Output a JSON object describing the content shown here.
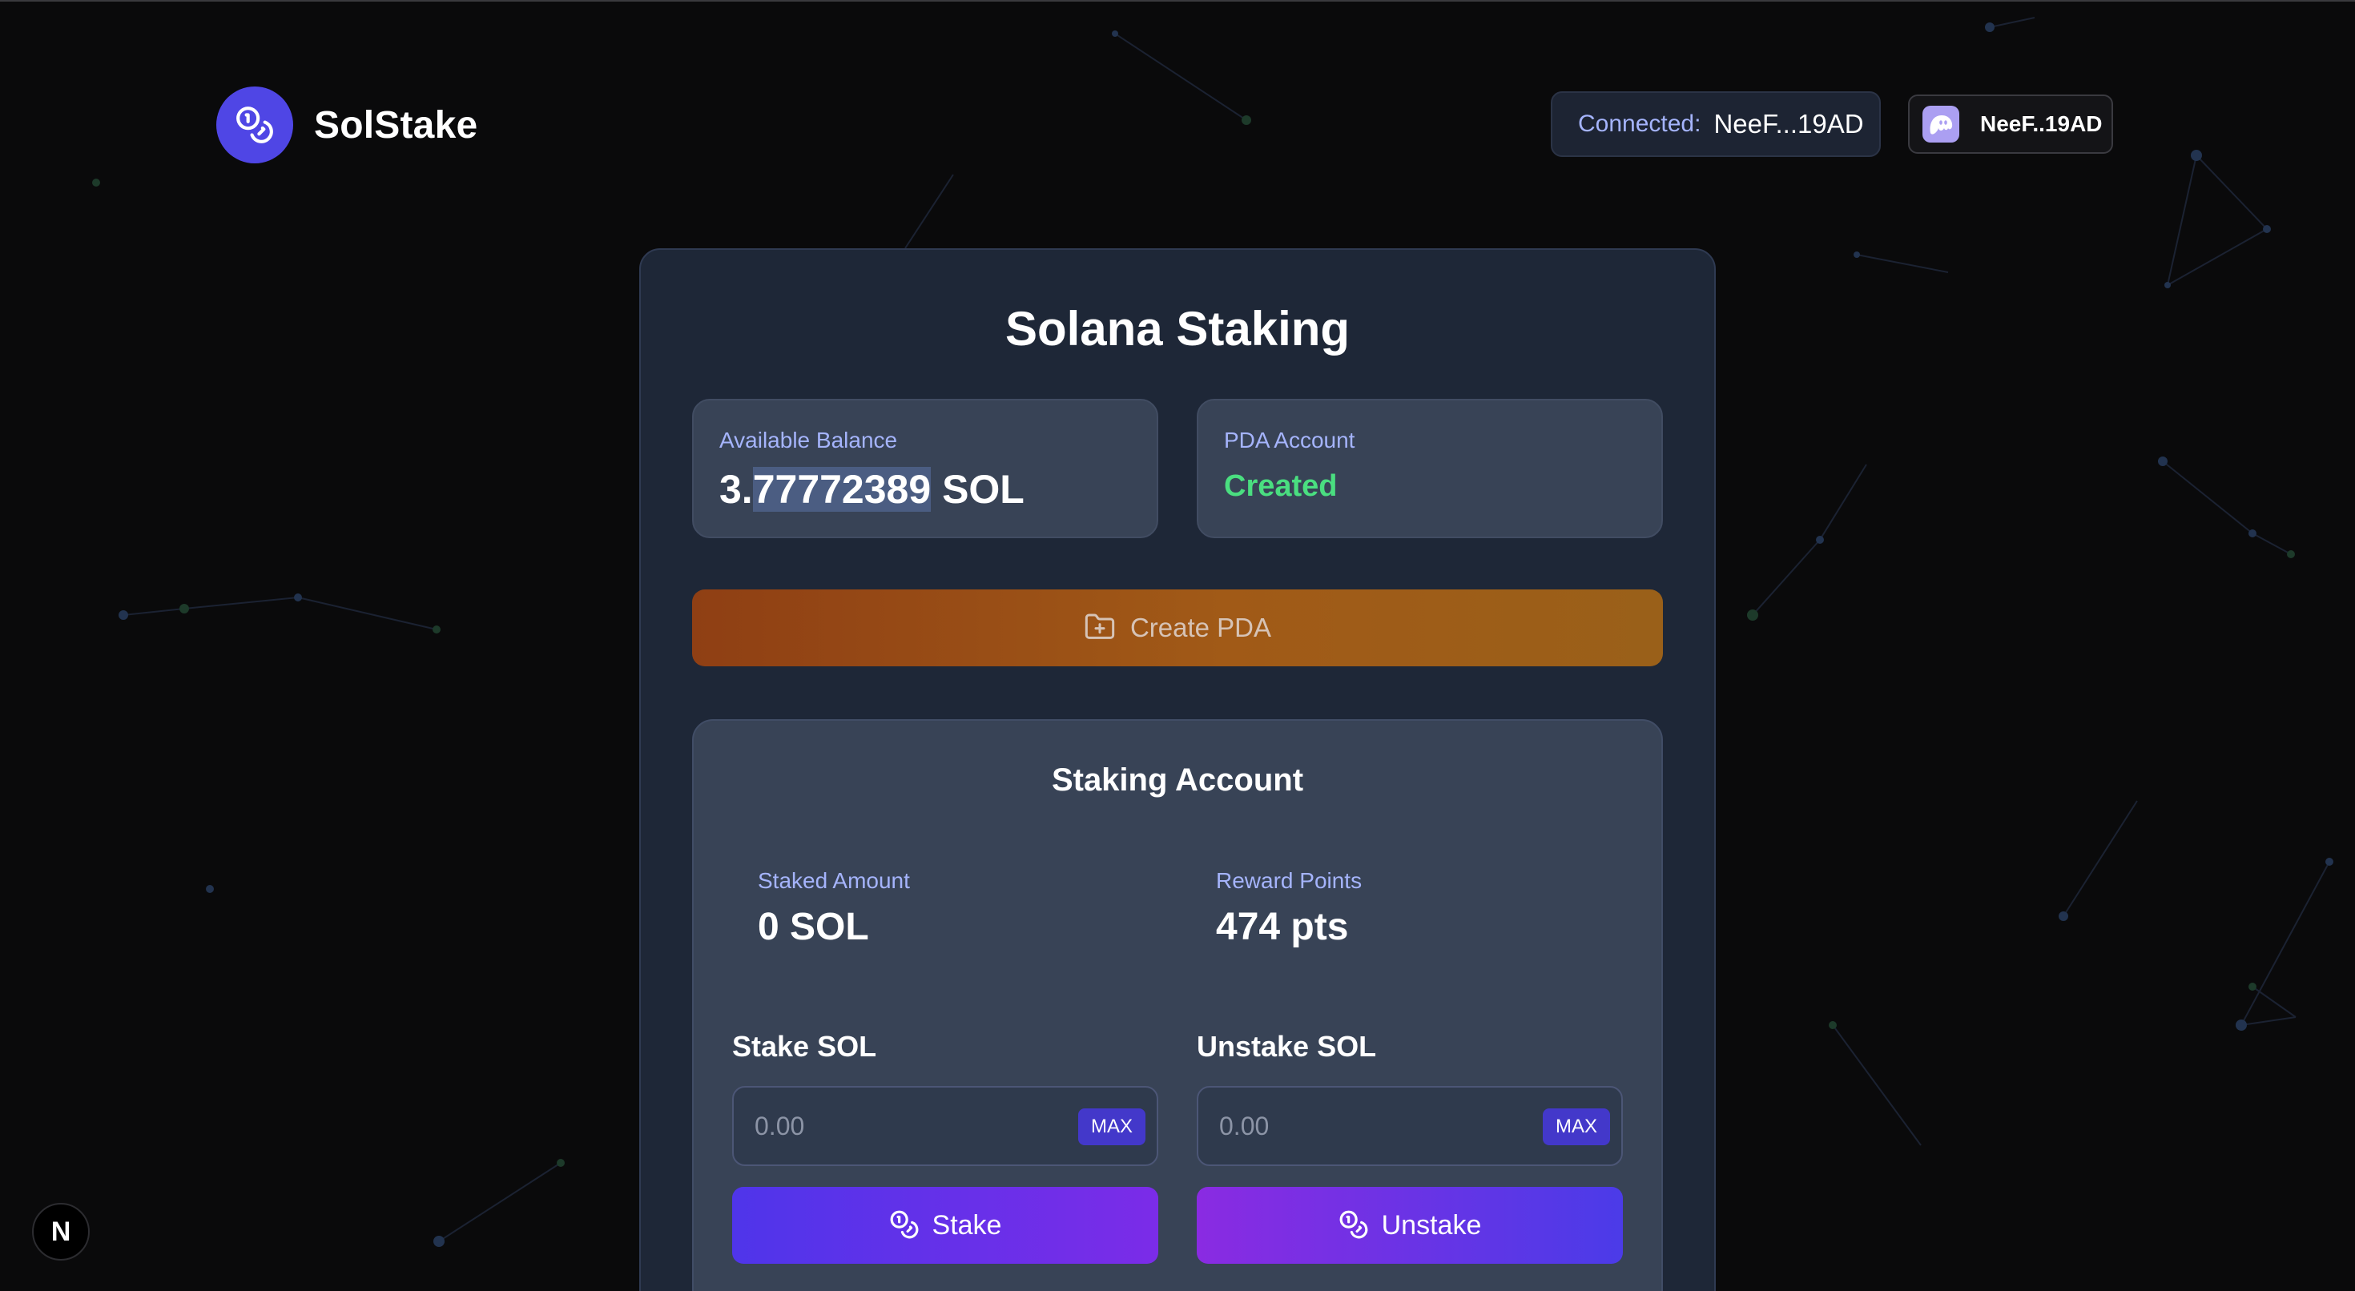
{
  "colors": {
    "background": "#0a0a0b",
    "accent": "#4f46e5",
    "card": "#1e2737",
    "panel": "#384356",
    "label": "#a5b4fc",
    "success": "#4ade80",
    "pda_gradient": [
      "#8f3f14",
      "#9a6019"
    ]
  },
  "header": {
    "brand_icon": "coins-icon",
    "brand_name": "SolStake",
    "connected_label": "Connected:",
    "connected_address": "NeeF...19AD",
    "wallet_icon": "phantom-ghost-icon",
    "wallet_address": "NeeF..19AD"
  },
  "card": {
    "title": "Solana Staking",
    "balance": {
      "label": "Available Balance",
      "value_prefix": "3.",
      "value_selected": "77772389",
      "value_suffix": " SOL"
    },
    "pda": {
      "label": "PDA Account",
      "status": "Created"
    },
    "create_pda": {
      "icon": "folder-plus-icon",
      "label": "Create PDA"
    },
    "staking_account": {
      "title": "Staking Account",
      "staked_label": "Staked Amount",
      "staked_value": "0 SOL",
      "reward_label": "Reward Points",
      "reward_value": "474 pts",
      "stake": {
        "heading": "Stake SOL",
        "placeholder": "0.00",
        "max_label": "MAX",
        "button_icon": "coins-icon",
        "button_label": "Stake"
      },
      "unstake": {
        "heading": "Unstake SOL",
        "placeholder": "0.00",
        "max_label": "MAX",
        "button_icon": "coins-icon",
        "button_label": "Unstake"
      }
    }
  },
  "dev_badge": {
    "icon": "nextjs-icon",
    "letter": "N"
  }
}
